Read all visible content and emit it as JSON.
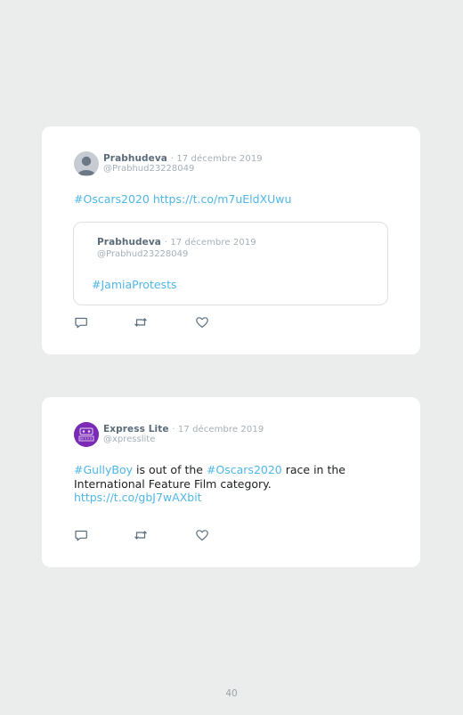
{
  "colors": {
    "link": "#4fb6e6",
    "name": "#5a6b7a",
    "meta": "#a4afb8",
    "background": "#ebecec",
    "card": "#ffffff"
  },
  "tweet1": {
    "author": "Prabhudeva",
    "date": "· 17 décembre 2019",
    "handle": "@Prabhud23228049",
    "text": {
      "hashtag": "#Oscars2020",
      "link": "https://t.co/m7uEldXUwu"
    },
    "quote": {
      "author": "Prabhudeva",
      "date": "· 17 décembre 2019",
      "handle": "@Prabhud23228049",
      "hashtag": "#JamiaProtests"
    },
    "actions": [
      "reply-icon",
      "retweet-icon",
      "like-icon"
    ]
  },
  "tweet2": {
    "author": "Express Lite",
    "date": "· 17 décembre 2019",
    "handle": "@xpresslite",
    "avatar_text": "EXPRESS LITE",
    "text": {
      "hashtag1": "#GullyBoy",
      "part1": " is out of the ",
      "hashtag2": "#Oscars2020",
      "part2": " race in the",
      "line2": "International Feature Film category.",
      "link": "https://t.co/gbJ7wAXbit"
    },
    "actions": [
      "reply-icon",
      "retweet-icon",
      "like-icon"
    ]
  },
  "page_number": "40"
}
